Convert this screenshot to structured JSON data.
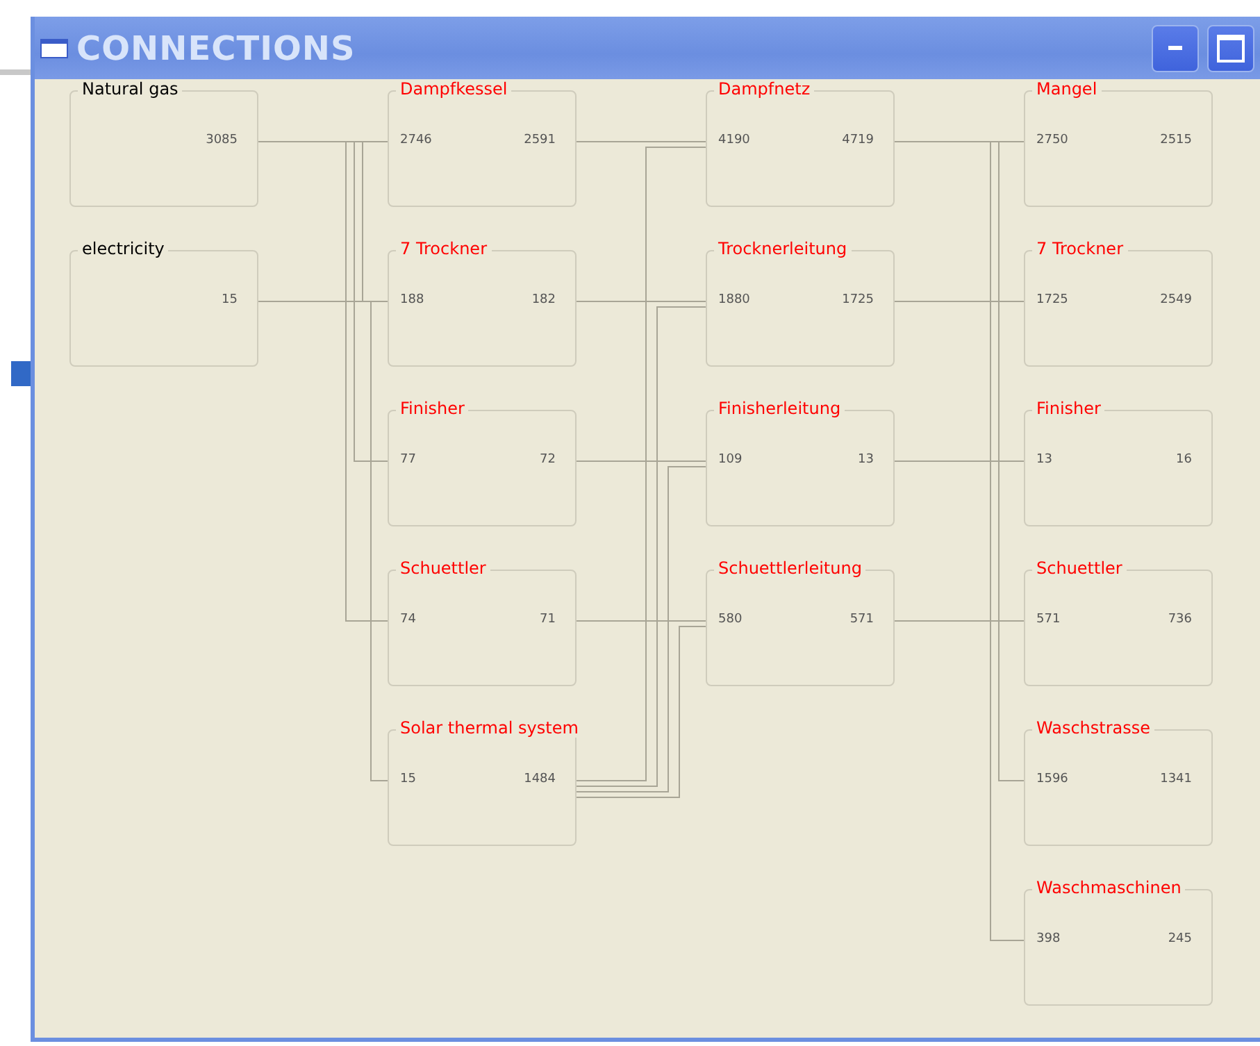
{
  "window": {
    "title": "CONNECTIONS"
  },
  "columns": [
    {
      "nodes": [
        {
          "title": "Natural gas",
          "kind": "source",
          "output": "3085"
        },
        {
          "title": "electricity",
          "kind": "source",
          "output": "15"
        }
      ]
    },
    {
      "nodes": [
        {
          "title": "Dampfkessel",
          "kind": "unit",
          "input": "2746",
          "output": "2591"
        },
        {
          "title": "7 Trockner",
          "kind": "unit",
          "input": "188",
          "output": "182"
        },
        {
          "title": "Finisher",
          "kind": "unit",
          "input": "77",
          "output": "72"
        },
        {
          "title": "Schuettler",
          "kind": "unit",
          "input": "74",
          "output": "71"
        },
        {
          "title": "Solar thermal system",
          "kind": "unit",
          "input": "15",
          "output": "1484"
        }
      ]
    },
    {
      "nodes": [
        {
          "title": "Dampfnetz",
          "kind": "unit",
          "input": "4190",
          "output": "4719"
        },
        {
          "title": "Trocknerleitung",
          "kind": "unit",
          "input": "1880",
          "output": "1725"
        },
        {
          "title": "Finisherleitung",
          "kind": "unit",
          "input": "109",
          "output": "13"
        },
        {
          "title": "Schuettlerleitung",
          "kind": "unit",
          "input": "580",
          "output": "571"
        }
      ]
    },
    {
      "nodes": [
        {
          "title": "Mangel",
          "kind": "unit",
          "input": "2750",
          "output": "2515"
        },
        {
          "title": "7 Trockner",
          "kind": "unit",
          "input": "1725",
          "output": "2549"
        },
        {
          "title": "Finisher",
          "kind": "unit",
          "input": "13",
          "output": "16"
        },
        {
          "title": "Schuettler",
          "kind": "unit",
          "input": "571",
          "output": "736"
        },
        {
          "title": "Waschstrasse",
          "kind": "unit",
          "input": "1596",
          "output": "1341"
        },
        {
          "title": "Waschmaschinen",
          "kind": "unit",
          "input": "398",
          "output": "245"
        }
      ]
    }
  ]
}
